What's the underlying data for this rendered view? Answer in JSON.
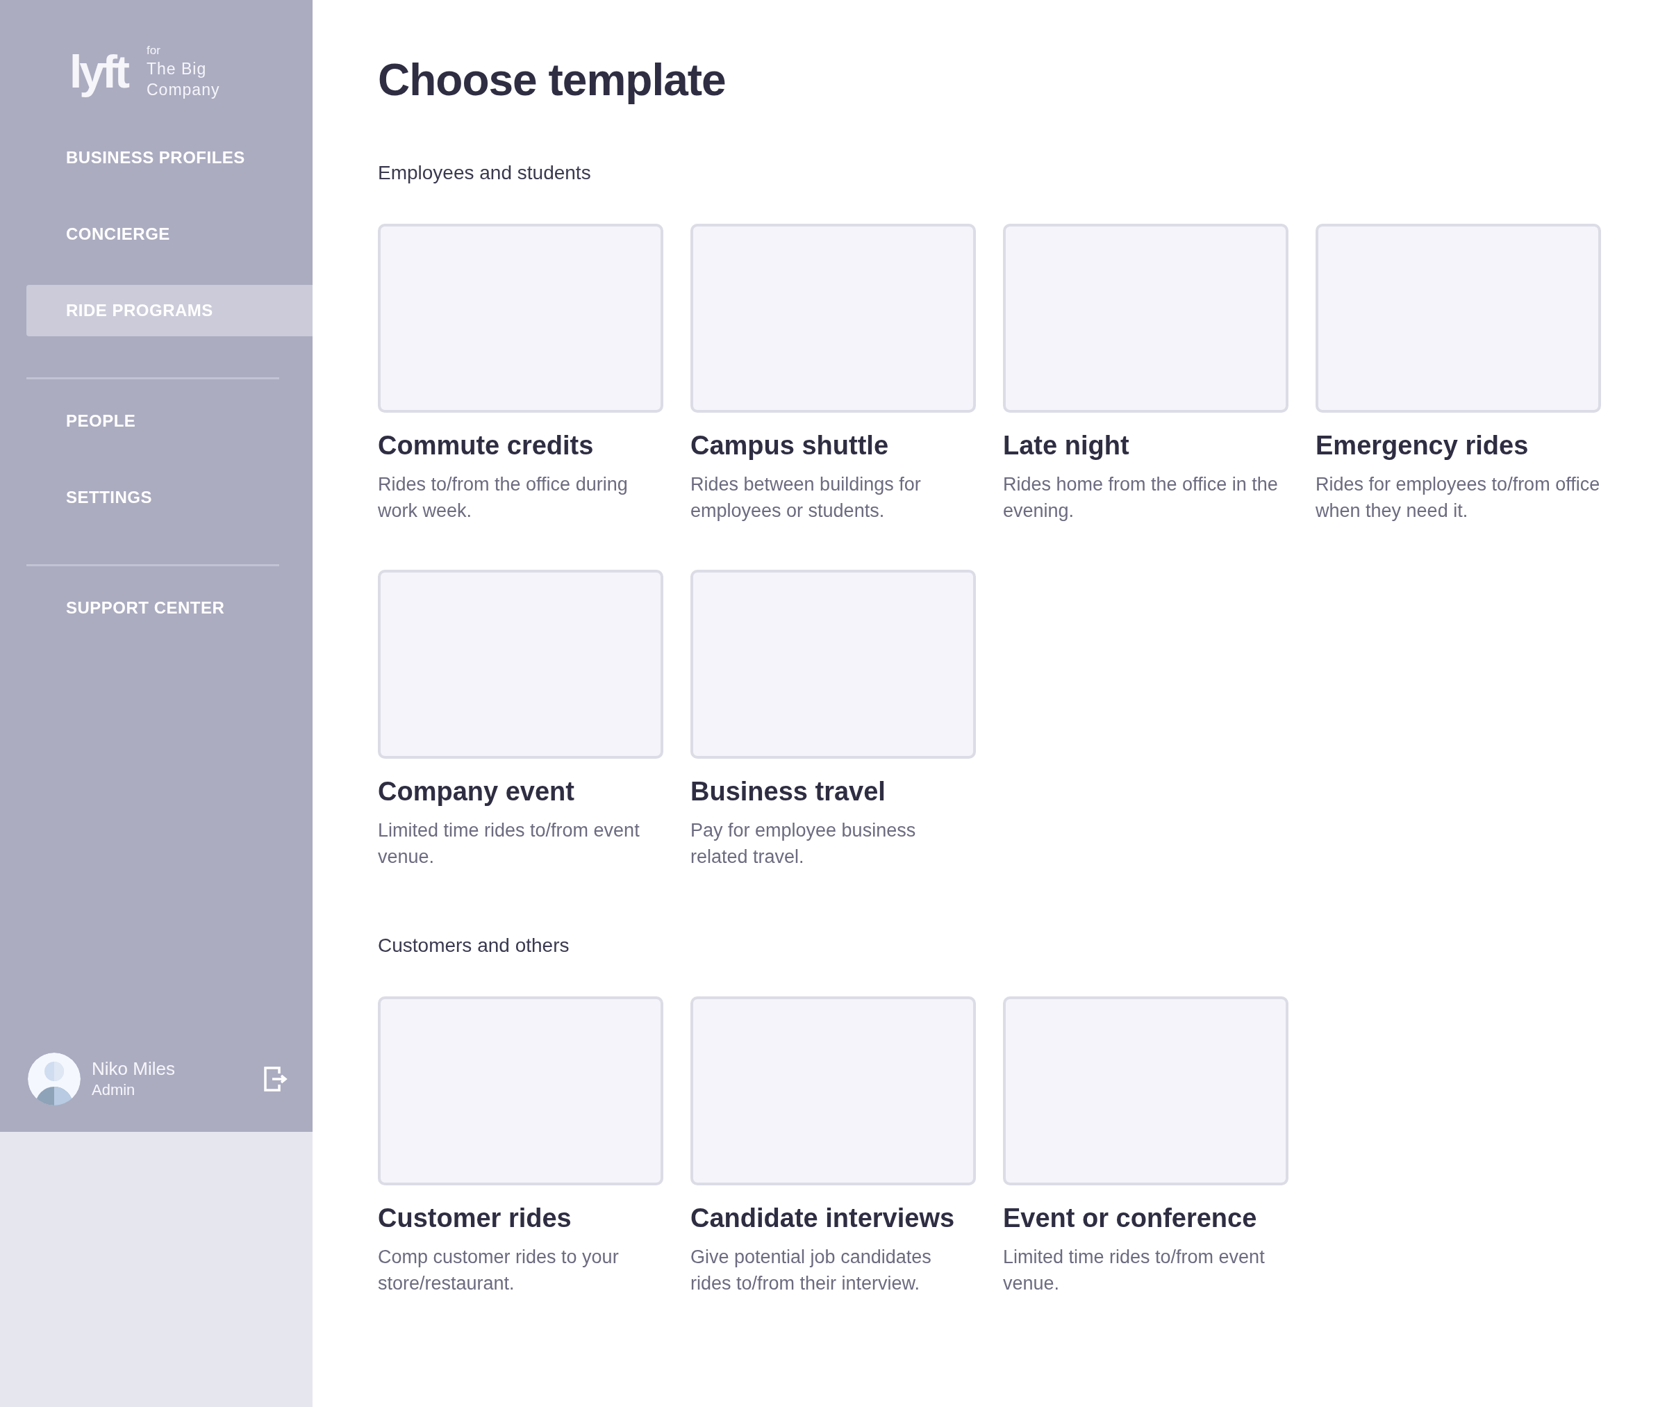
{
  "sidebar": {
    "logo": "lyft",
    "for_label": "for",
    "company": "The Big Company",
    "nav_groups": [
      [
        {
          "label": "BUSINESS PROFILES",
          "selected": false
        },
        {
          "label": "CONCIERGE",
          "selected": false
        },
        {
          "label": "RIDE PROGRAMS",
          "selected": true
        }
      ],
      [
        {
          "label": "PEOPLE",
          "selected": false
        },
        {
          "label": "SETTINGS",
          "selected": false
        }
      ],
      [
        {
          "label": "SUPPORT CENTER",
          "selected": false
        }
      ]
    ],
    "user": {
      "name": "Niko Miles",
      "role": "Admin"
    }
  },
  "title": "Choose template",
  "sections": [
    {
      "heading": "Employees and students",
      "templates": [
        {
          "title": "Commute credits",
          "description": "Rides to/from the office during work week."
        },
        {
          "title": "Campus shuttle",
          "description": "Rides between buildings for employees or students."
        },
        {
          "title": "Late night",
          "description": "Rides home from the office in the evening."
        },
        {
          "title": "Emergency rides",
          "description": "Rides for employees to/from office when they need it."
        },
        {
          "title": "Company event",
          "description": "Limited time rides to/from event venue."
        },
        {
          "title": "Business travel",
          "description": "Pay for employee business related travel."
        }
      ]
    },
    {
      "heading": "Customers and others",
      "templates": [
        {
          "title": "Customer rides",
          "description": "Comp customer rides to your store/restaurant."
        },
        {
          "title": "Candidate interviews",
          "description": "Give potential job candidates rides to/from their interview."
        },
        {
          "title": "Event or conference",
          "description": "Limited time rides to/from event venue."
        }
      ]
    }
  ]
}
